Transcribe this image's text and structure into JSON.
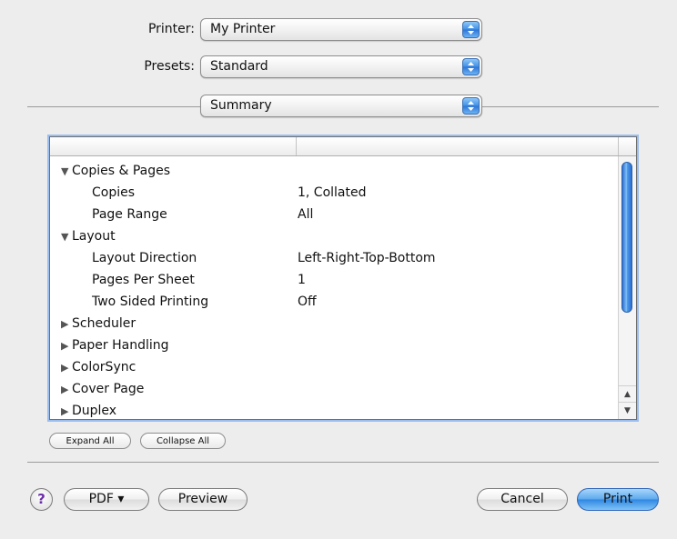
{
  "printer": {
    "label": "Printer:",
    "value": "My Printer"
  },
  "presets": {
    "label": "Presets:",
    "value": "Standard"
  },
  "panel": {
    "value": "Summary"
  },
  "summary_list": {
    "columns": [
      "",
      ""
    ],
    "rows": [
      {
        "label": "Copies & Pages",
        "value": "",
        "expander": "▼",
        "level": 0
      },
      {
        "label": "Copies",
        "value": "1, Collated",
        "expander": "",
        "level": 1
      },
      {
        "label": "Page Range",
        "value": "All",
        "expander": "",
        "level": 1
      },
      {
        "label": "Layout",
        "value": "",
        "expander": "▼",
        "level": 0
      },
      {
        "label": "Layout Direction",
        "value": "Left-Right-Top-Bottom",
        "expander": "",
        "level": 1
      },
      {
        "label": "Pages Per Sheet",
        "value": "1",
        "expander": "",
        "level": 1
      },
      {
        "label": "Two Sided Printing",
        "value": "Off",
        "expander": "",
        "level": 1
      },
      {
        "label": "Scheduler",
        "value": "",
        "expander": "▶",
        "level": 0
      },
      {
        "label": "Paper Handling",
        "value": "",
        "expander": "▶",
        "level": 0
      },
      {
        "label": "ColorSync",
        "value": "",
        "expander": "▶",
        "level": 0
      },
      {
        "label": "Cover Page",
        "value": "",
        "expander": "▶",
        "level": 0
      },
      {
        "label": "Duplex",
        "value": "",
        "expander": "▶",
        "level": 0
      }
    ]
  },
  "list_buttons": {
    "expand_all": "Expand All",
    "collapse_all": "Collapse All"
  },
  "footer": {
    "help": "?",
    "pdf": "PDF ▾",
    "preview": "Preview",
    "cancel": "Cancel",
    "print": "Print"
  },
  "colors": {
    "accent": "#3f8ee6",
    "background": "#ededed"
  },
  "icons": {
    "help": "help-icon",
    "popup_arrows": "popup-arrows-icon",
    "disclosure": "disclosure-triangle-icon"
  }
}
